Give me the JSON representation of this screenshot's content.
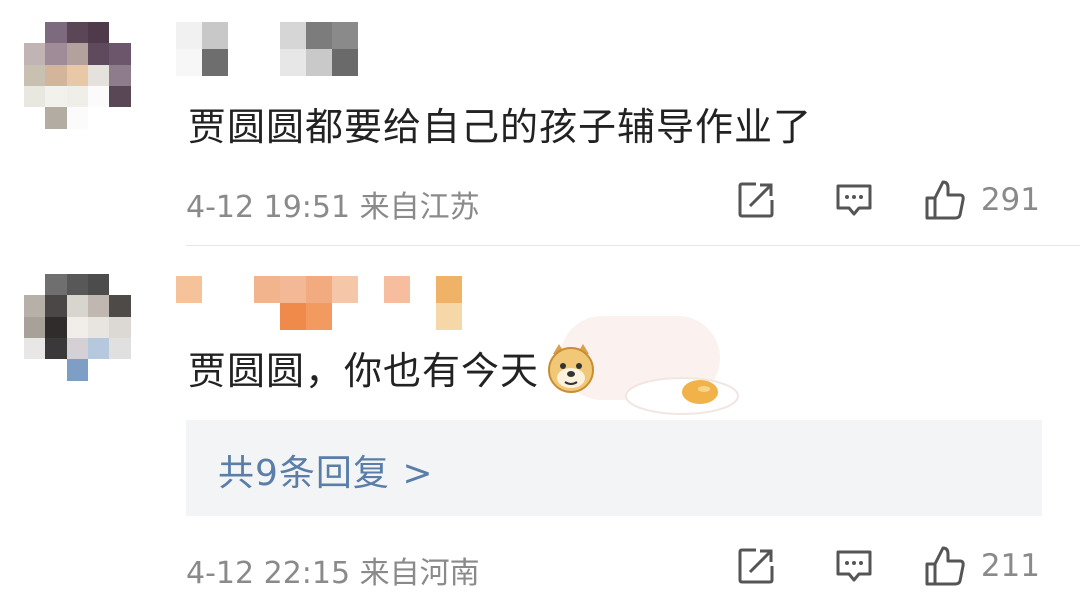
{
  "comments": [
    {
      "text": "贾圆圆都要给自己的孩子辅导作业了",
      "timestamp": "4-12 19:51 来自江苏",
      "likes": "291"
    },
    {
      "text": "贾圆圆，你也有今天",
      "timestamp": "4-12 22:15 来自河南",
      "likes": "211",
      "replies_label": "共9条回复 >"
    }
  ],
  "icons": {
    "share": "share-icon",
    "comment": "comment-icon",
    "like": "thumbs-up-icon",
    "emoji": "doge-emoji-icon",
    "egg": "fried-egg-icon"
  },
  "colors": {
    "text": "#222222",
    "meta": "#8a8a8a",
    "link": "#5a7ea8",
    "reply_box": "#f3f4f5",
    "divider": "#e6e6e6"
  }
}
